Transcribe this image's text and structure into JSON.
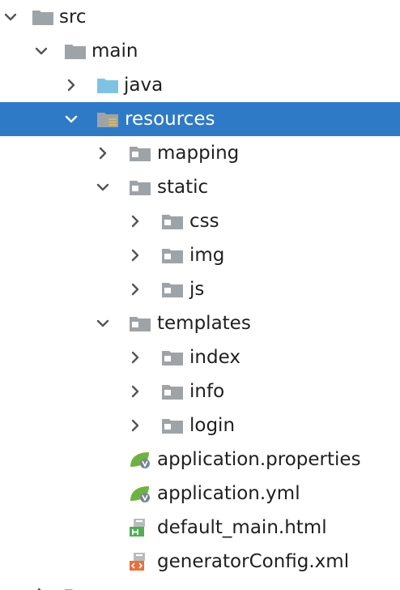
{
  "tree": {
    "nodes": [
      {
        "label": "src",
        "expanded": true,
        "icon": "folder-icon"
      },
      {
        "label": "main",
        "expanded": true,
        "icon": "folder-icon"
      },
      {
        "label": "java",
        "expanded": false,
        "icon": "source-folder-icon"
      },
      {
        "label": "resources",
        "expanded": true,
        "icon": "resources-folder-icon",
        "selected": true
      },
      {
        "label": "mapping",
        "expanded": false,
        "icon": "folder-icon"
      },
      {
        "label": "static",
        "expanded": true,
        "icon": "folder-icon"
      },
      {
        "label": "css",
        "expanded": false,
        "icon": "folder-icon"
      },
      {
        "label": "img",
        "expanded": false,
        "icon": "folder-icon"
      },
      {
        "label": "js",
        "expanded": false,
        "icon": "folder-icon"
      },
      {
        "label": "templates",
        "expanded": true,
        "icon": "folder-icon"
      },
      {
        "label": "index",
        "expanded": false,
        "icon": "folder-icon"
      },
      {
        "label": "info",
        "expanded": false,
        "icon": "folder-icon"
      },
      {
        "label": "login",
        "expanded": false,
        "icon": "folder-icon"
      },
      {
        "label": "application.properties",
        "icon": "spring-config-file-icon"
      },
      {
        "label": "application.yml",
        "icon": "spring-config-file-icon"
      },
      {
        "label": "default_main.html",
        "icon": "html-file-icon"
      },
      {
        "label": "generatorConfig.xml",
        "icon": "xml-file-icon"
      }
    ]
  },
  "colors": {
    "selection": "#2f7ac6",
    "folder": "#9ea3a8",
    "source_folder": "#7ec3e6",
    "spring": "#6db33f",
    "html_badge": "#4caf50",
    "xml_badge": "#e8703a"
  }
}
